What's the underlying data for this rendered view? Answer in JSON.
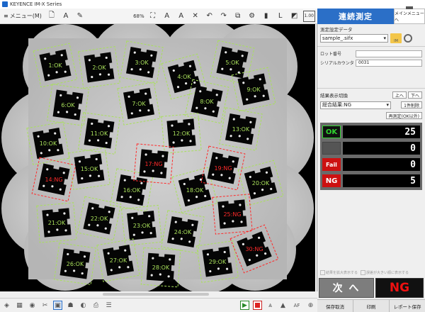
{
  "window": {
    "title": "KEYENCE IM-X Series"
  },
  "toolbar": {
    "menu_label": "メニュー(M)",
    "zoom": "68%",
    "scale_value": "1.00"
  },
  "panel": {
    "header_title": "連続測定",
    "menu_button": "メインメニューへ",
    "setting_data_label": "測定設定データ",
    "file_name": "sample_.sifx",
    "folder_tag": "IM",
    "lot_label": "ロット番号",
    "lot_value": "",
    "serial_label": "シリアルカウンタ",
    "serial_value": "0031",
    "result_switch_label": "結果表示切換",
    "up_btn": "上へ",
    "down_btn": "下へ",
    "result_select": "総合結果:NG",
    "delete_btn": "1件削除",
    "remeasure_btn": "再測定(OK以外)",
    "counts": [
      {
        "badge": "OK",
        "kind": "ok",
        "value": "25"
      },
      {
        "badge": "",
        "kind": "none",
        "value": "0"
      },
      {
        "badge": "Fail",
        "kind": "fail",
        "value": "0"
      },
      {
        "badge": "NG",
        "kind": "ng",
        "value": "5"
      }
    ],
    "check_enlarge": "結果を拡大表示する",
    "check_large_error": "誤差が大きい順に表示する",
    "next_button": "次 へ",
    "overall_result": "NG",
    "footer": [
      "保存取消",
      "印刷",
      "レポート保存"
    ]
  },
  "colors": {
    "ok": "#a8e05a",
    "ng": "#ff2a2a",
    "accent": "#2b6fc7"
  },
  "parts": [
    {
      "label": "1:OK",
      "status": "ok"
    },
    {
      "label": "2:OK",
      "status": "ok"
    },
    {
      "label": "3:OK",
      "status": "ok"
    },
    {
      "label": "4:OK",
      "status": "ok"
    },
    {
      "label": "5:OK",
      "status": "ok"
    },
    {
      "label": "6:OK",
      "status": "ok"
    },
    {
      "label": "7:OK",
      "status": "ok"
    },
    {
      "label": "8:OK",
      "status": "ok"
    },
    {
      "label": "9:OK",
      "status": "ok"
    },
    {
      "label": "10:OK",
      "status": "ok"
    },
    {
      "label": "11:OK",
      "status": "ok"
    },
    {
      "label": "12:OK",
      "status": "ok"
    },
    {
      "label": "13:OK",
      "status": "ok"
    },
    {
      "label": "14:NG",
      "status": "ng"
    },
    {
      "label": "15:OK",
      "status": "ok"
    },
    {
      "label": "16:OK",
      "status": "ok"
    },
    {
      "label": "17:NG",
      "status": "ng"
    },
    {
      "label": "18:OK",
      "status": "ok"
    },
    {
      "label": "19:NG",
      "status": "ng"
    },
    {
      "label": "20:OK",
      "status": "ok"
    },
    {
      "label": "21:OK",
      "status": "ok"
    },
    {
      "label": "22:OK",
      "status": "ok"
    },
    {
      "label": "23:OK",
      "status": "ok"
    },
    {
      "label": "24:OK",
      "status": "ok"
    },
    {
      "label": "25:NG",
      "status": "ng"
    },
    {
      "label": "26:OK",
      "status": "ok"
    },
    {
      "label": "27:OK",
      "status": "ok"
    },
    {
      "label": "28:OK",
      "status": "ok"
    },
    {
      "label": "29:OK",
      "status": "ok"
    },
    {
      "label": "30:NG",
      "status": "ng"
    }
  ]
}
